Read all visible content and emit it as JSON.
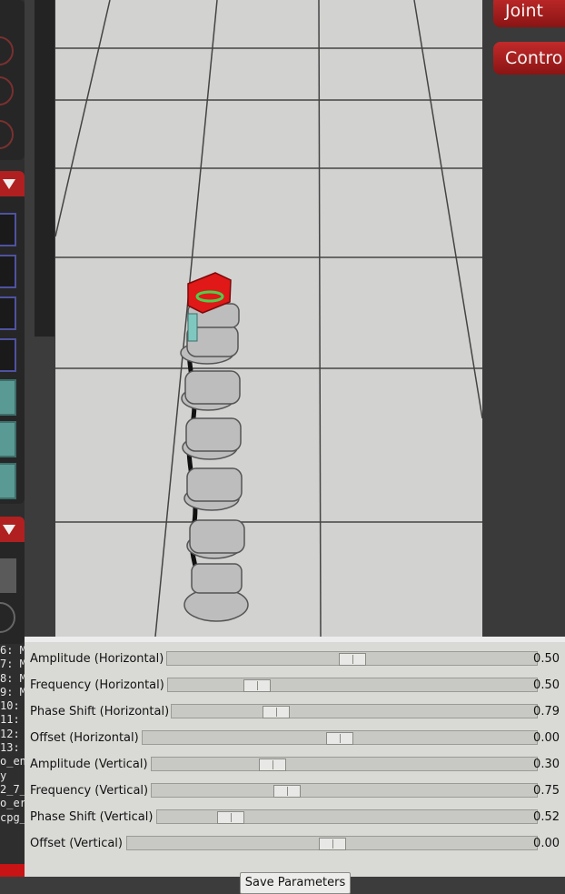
{
  "right_panel": {
    "buttons": [
      "Joint",
      "Contro"
    ]
  },
  "log": {
    "lines": [
      "6: M",
      "7: M",
      "8: M",
      "9: M",
      "10:",
      "11:",
      "12:",
      "13:",
      "o_en",
      "y",
      "2_7_",
      "o_er",
      "cpg_"
    ]
  },
  "sliders": [
    {
      "label": "Amplitude (Horizontal)",
      "value": "0.50",
      "position": 0.5
    },
    {
      "label": "Frequency (Horizontal)",
      "value": "0.50",
      "position": 0.22
    },
    {
      "label": "Phase Shift (Horizontal)",
      "value": "0.79",
      "position": 0.27
    },
    {
      "label": "Offset (Horizontal)",
      "value": "0.00",
      "position": 0.5
    },
    {
      "label": "Amplitude (Vertical)",
      "value": "0.30",
      "position": 0.3
    },
    {
      "label": "Frequency (Vertical)",
      "value": "0.75",
      "position": 0.34
    },
    {
      "label": "Phase Shift (Vertical)",
      "value": "0.52",
      "position": 0.17
    },
    {
      "label": "Offset (Vertical)",
      "value": "0.00",
      "position": 0.5
    }
  ],
  "save_button": "Save Parameters",
  "colors": {
    "accent_red": "#b02020",
    "teal": "#5a9a94",
    "viewport_floor": "#d2d2d0"
  }
}
